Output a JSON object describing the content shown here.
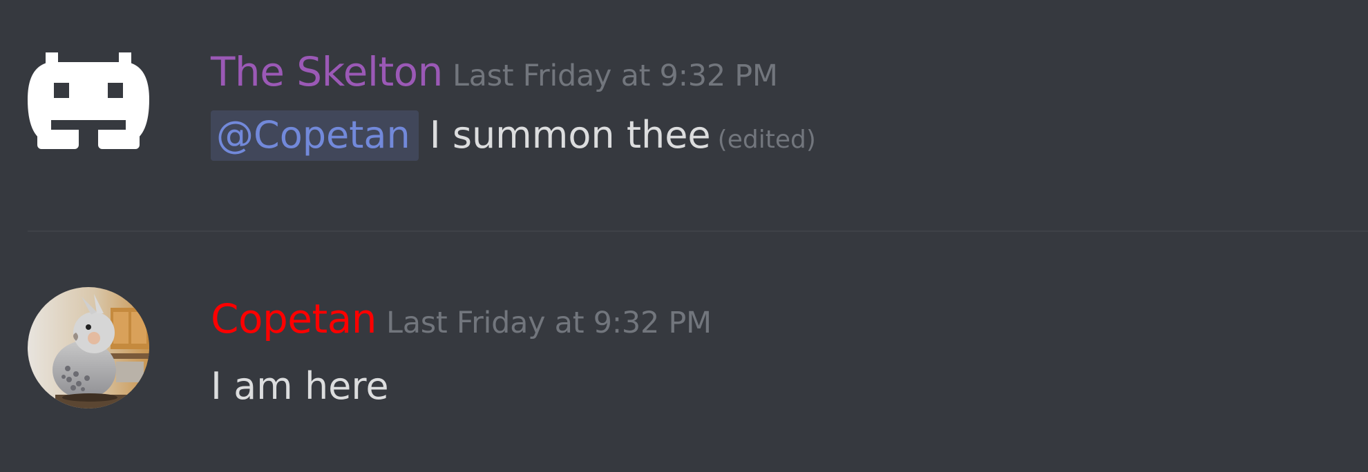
{
  "messages": [
    {
      "author": "The Skelton",
      "author_color": "#9b59b6",
      "timestamp": "Last Friday at 9:32 PM",
      "mention": "@Copetan",
      "text": "I summon thee",
      "edited_label": "(edited)",
      "avatar_icon": "space-invader-icon"
    },
    {
      "author": "Copetan",
      "author_color": "#ff0000",
      "timestamp": "Last Friday at 9:32 PM",
      "text": "I am here",
      "avatar_icon": "cockatiel-photo"
    }
  ],
  "colors": {
    "background": "#36393f",
    "text": "#dcddde",
    "muted": "#72767d",
    "mention": "#7289da"
  }
}
